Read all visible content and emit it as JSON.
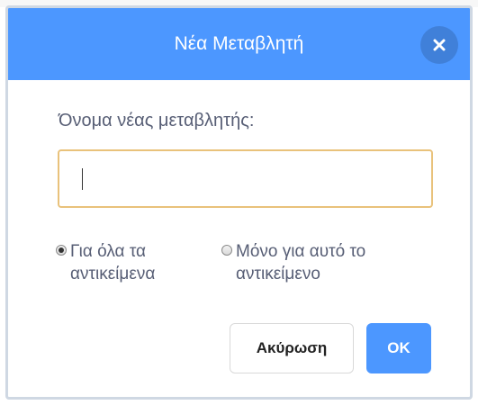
{
  "dialog": {
    "title": "Νέα Μεταβλητή",
    "close_icon": "close-icon",
    "name_label": "Όνομα νέας μεταβλητής:",
    "name_input_value": "",
    "scope_options": [
      {
        "label": "Για όλα τα αντικείμενα",
        "checked": true
      },
      {
        "label": "Μόνο για αυτό το αντικείμενο",
        "checked": false
      }
    ],
    "cancel_label": "Ακύρωση",
    "ok_label": "OK"
  },
  "colors": {
    "header": "#4c97ff",
    "ok_button": "#4c97ff",
    "input_border": "#e9c27b",
    "text": "#575e75"
  }
}
